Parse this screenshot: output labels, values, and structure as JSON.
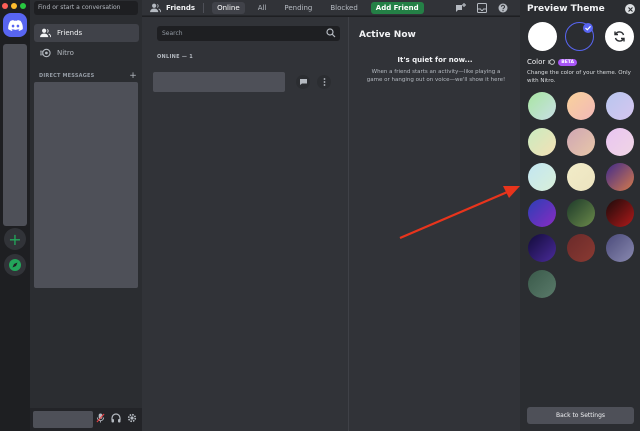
{
  "sidebar": {
    "search_placeholder": "Find or start a conversation",
    "items": [
      {
        "label": "Friends",
        "icon": "friends-icon",
        "active": true
      },
      {
        "label": "Nitro",
        "icon": "nitro-icon",
        "active": false
      }
    ],
    "dm_header": "DIRECT MESSAGES",
    "dm_add": "+"
  },
  "header": {
    "title": "Friends",
    "tabs": [
      "Online",
      "All",
      "Pending",
      "Blocked"
    ],
    "active_tab": "Online",
    "add_friend": "Add Friend"
  },
  "main": {
    "search_placeholder": "Search",
    "online_label": "ONLINE — 1"
  },
  "active_now": {
    "title": "Active Now",
    "quiet_title": "It's quiet for now...",
    "quiet_desc": "When a friend starts an activity—like playing a game or hanging out on voice—we'll show it here!"
  },
  "theme": {
    "title": "Preview Theme",
    "color_label": "Color",
    "beta": "BETA",
    "description": "Change the color of your theme. Only with Nitro.",
    "back_button": "Back to Settings",
    "modes": [
      {
        "name": "light",
        "color": "#ffffff"
      },
      {
        "name": "dark",
        "color": "#2b2d31",
        "selected": true
      },
      {
        "name": "sync",
        "color": "#ffffff"
      }
    ],
    "swatches": [
      "linear-gradient(135deg,#a8e6a1,#c9dfe6)",
      "linear-gradient(135deg,#f9d29b,#f2b8b8)",
      "linear-gradient(135deg,#b8c7ef,#d6c5ef)",
      "linear-gradient(135deg,#c9ecc0,#f4e0b5)",
      "linear-gradient(135deg,#cfa6b4,#e8c7a8)",
      "linear-gradient(135deg,#e9c5f2,#f0d5e4)",
      "linear-gradient(135deg,#c2e6f2,#d9f0d9)",
      "linear-gradient(135deg,#f2ecc8,#ece3bf)",
      "linear-gradient(135deg,#3f2b8c,#d67a4a)",
      "linear-gradient(135deg,#2b3fb6,#8a2bc2)",
      "linear-gradient(135deg,#1d3a2a,#6b8a4a)",
      "linear-gradient(135deg,#1a0a0a,#b01a1a)",
      "linear-gradient(135deg,#120b3a,#4a2b9a)",
      "linear-gradient(135deg,#6a2a2a,#8a3a32)",
      "linear-gradient(135deg,#4a4a7a,#8a8ab0)",
      "linear-gradient(135deg,#3a5a4a,#5a7a6a)"
    ]
  },
  "colors": {
    "blurple": "#5865f2",
    "green": "#23a55a",
    "add_friend_green": "#248046",
    "arrow": "#e8341c"
  }
}
